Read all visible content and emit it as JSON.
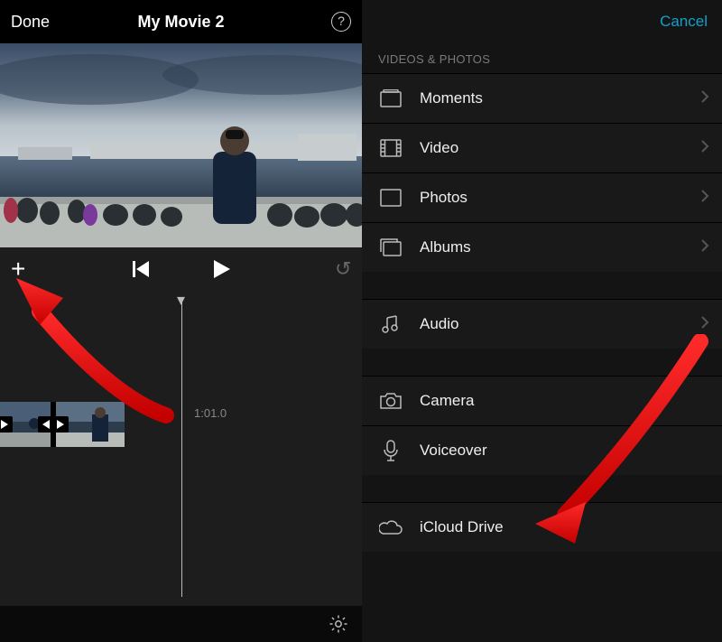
{
  "left": {
    "done": "Done",
    "title": "My Movie 2",
    "timecode": "1:01.0"
  },
  "right": {
    "cancel": "Cancel",
    "section": "VIDEOS & PHOTOS",
    "rows": {
      "moments": "Moments",
      "video": "Video",
      "photos": "Photos",
      "albums": "Albums",
      "audio": "Audio",
      "camera": "Camera",
      "voiceover": "Voiceover",
      "icloud": "iCloud Drive"
    }
  }
}
